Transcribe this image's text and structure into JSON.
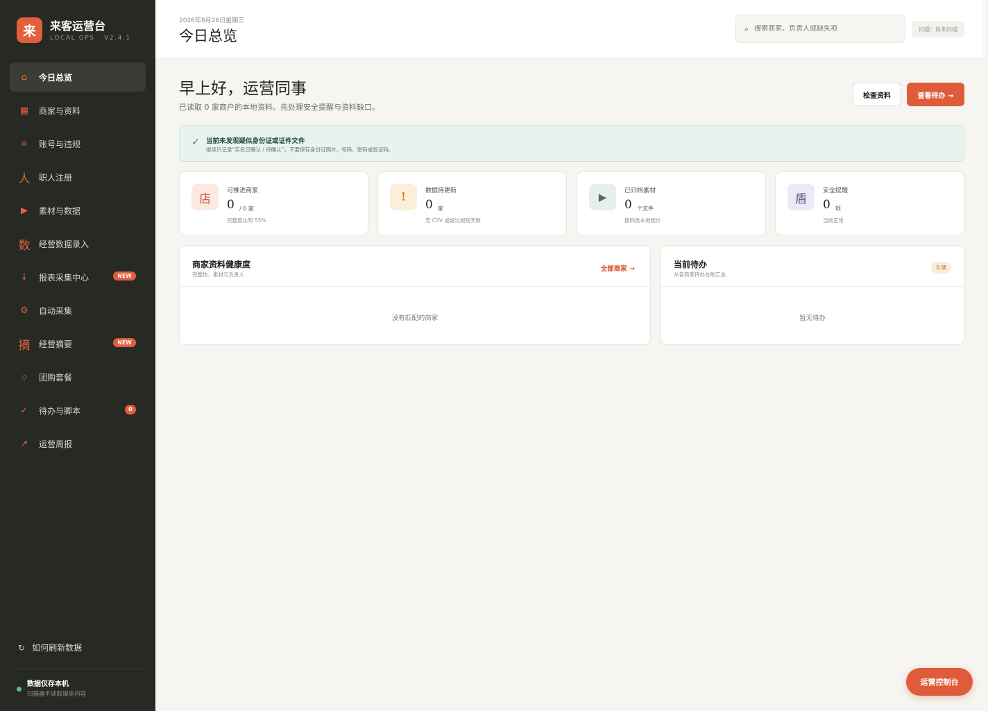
{
  "brand": {
    "logo": "来",
    "title": "来客运营台",
    "subtitle": "LOCAL OPS · V2.4.1"
  },
  "sidebar": {
    "items": [
      {
        "icon": "⌂",
        "icon_name": "home-icon",
        "label": "今日总览",
        "active": true
      },
      {
        "icon": "▦",
        "icon_name": "grid-icon",
        "label": "商家与资料"
      },
      {
        "icon": "⊚",
        "icon_name": "target-icon",
        "label": "账号与违规"
      },
      {
        "icon": "人",
        "icon_name": "person-icon",
        "label": "职人注册"
      },
      {
        "icon": "▶",
        "icon_name": "play-icon",
        "label": "素材与数据"
      },
      {
        "icon": "数",
        "icon_name": "data-icon",
        "label": "经营数据录入"
      },
      {
        "icon": "↓",
        "icon_name": "download-icon",
        "label": "报表采集中心",
        "badge": "NEW"
      },
      {
        "icon": "⚙",
        "icon_name": "gear-icon",
        "label": "自动采集"
      },
      {
        "icon": "摘",
        "icon_name": "summary-icon",
        "label": "经营摘要",
        "badge": "NEW"
      },
      {
        "icon": "◇",
        "icon_name": "diamond-icon",
        "label": "团购套餐"
      },
      {
        "icon": "✓",
        "icon_name": "check-icon",
        "label": "待办与脚本",
        "badge": "0"
      },
      {
        "icon": "↗",
        "icon_name": "trend-icon",
        "label": "运营周报"
      }
    ],
    "refresh": {
      "icon": "↻",
      "label": "如何刷新数据"
    },
    "local": {
      "title": "数据仅存本机",
      "subtitle": "扫描器不读取媒体内容"
    }
  },
  "header": {
    "date": "2026年8月26日星期三",
    "title": "今日总览",
    "search_placeholder": "搜索商家、负责人或缺失项",
    "scan_status": "扫描：尚未扫描"
  },
  "main": {
    "greeting": "早上好，运营同事",
    "greeting_sub": "已读取 0 家商户的本地资料。先处理安全提醒与资料缺口。",
    "btn_check": "检查资料",
    "btn_todo": "查看待办 →",
    "alert": {
      "icon": "✓",
      "title": "当前未发现疑似身份证或证件文件",
      "subtitle": "继续只记录“实名已确认 / 待确认”，不要保存身份证照片、号码、密码或验证码。"
    },
    "stats": [
      {
        "icon": "店",
        "label": "可推进商家",
        "value": "0",
        "unit": "/ 0 家",
        "sub": "完整度达到 55%",
        "bg": "#fbe9e2",
        "fg": "#d4552f"
      },
      {
        "icon": "!",
        "label": "数据待更新",
        "value": "0",
        "unit": "家",
        "sub": "无 CSV 或超过规则天数",
        "bg": "#fcefd9",
        "fg": "#c9821f"
      },
      {
        "icon": "▶",
        "label": "已归档素材",
        "value": "0",
        "unit": "个文件",
        "sub": "按四类本地统计",
        "bg": "#e7efea",
        "fg": "#4f6b5b"
      },
      {
        "icon": "盾",
        "label": "安全提醒",
        "value": "0",
        "unit": "项",
        "sub": "当前正常",
        "bg": "#eceaf6",
        "fg": "#5e5590"
      }
    ],
    "health": {
      "title": "商家资料健康度",
      "subtitle": "完整性、素材与负责人",
      "link": "全部商家 →",
      "empty": "没有匹配的商家"
    },
    "todo": {
      "title": "当前待办",
      "subtitle": "从各商家待办台账汇总",
      "badge": "0 项",
      "empty": "暂无待办"
    }
  },
  "fab": "运营控制台"
}
